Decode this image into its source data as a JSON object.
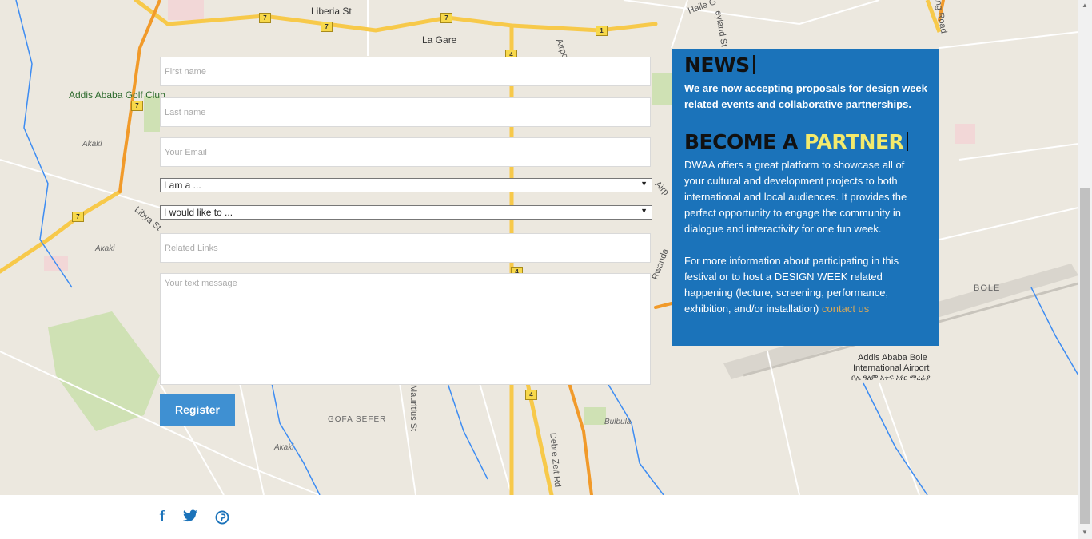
{
  "map": {
    "streets": {
      "liberia": "Liberia St",
      "haile": "Haile G",
      "ring_road": "Ring Road",
      "airport": "Airpo",
      "airport2": "Airp",
      "libya": "Libya St",
      "mauritius": "Mauritius St",
      "debre_zeit": "Debre Zeit Rd",
      "wanda": "Rwanda",
      "leyland": "eyland St"
    },
    "places": {
      "la_gare": "La Gare",
      "golf_club": "Addis Ababa Golf Club",
      "akaki1": "Akaki",
      "akaki2": "Akaki",
      "akaki3": "Akaki",
      "gofa": "GOFA SEFER",
      "bulbula": "Bulbula",
      "bole": "BOLE",
      "airport_name_1": "Addis Ababa Bole",
      "airport_name_2": "International Airport",
      "airport_name_3": "ቦሌ ዓለም አቀፍ አየር ማረፊያ"
    },
    "route_numbers": [
      "7",
      "7",
      "7",
      "7",
      "7",
      "4",
      "4",
      "4",
      "1"
    ]
  },
  "form": {
    "first_name_placeholder": "First name",
    "last_name_placeholder": "Last name",
    "email_placeholder": "Your Email",
    "iam_selected": "I am a ...",
    "would_like_selected": "I would like to ...",
    "links_placeholder": "Related Links",
    "message_placeholder": "Your text message",
    "register_label": "Register"
  },
  "panel": {
    "news_title": "NEWS",
    "news_text": "We are now accepting proposals for design week related events and collaborative partnerships.",
    "partner_title_a": "BECOME A",
    "partner_title_b": "PARTNER",
    "para1": "DWAA offers a great platform to showcase all of your cultural and development projects to both international and local audiences. It provides the perfect opportunity to engage the community in dialogue and interactivity for one fun week.",
    "para2": "For more information about participating in this festival or to host a DESIGN WEEK related happening (lecture, screening, performance, exhibition, and/or installation)",
    "contact_link": "contact us"
  },
  "footer": {
    "facebook": "f",
    "twitter": "🐦",
    "pinterest": "℗"
  },
  "colors": {
    "panel_bg": "#1b73ba",
    "highlight": "#f3ea6c",
    "button": "#3f90d2"
  }
}
